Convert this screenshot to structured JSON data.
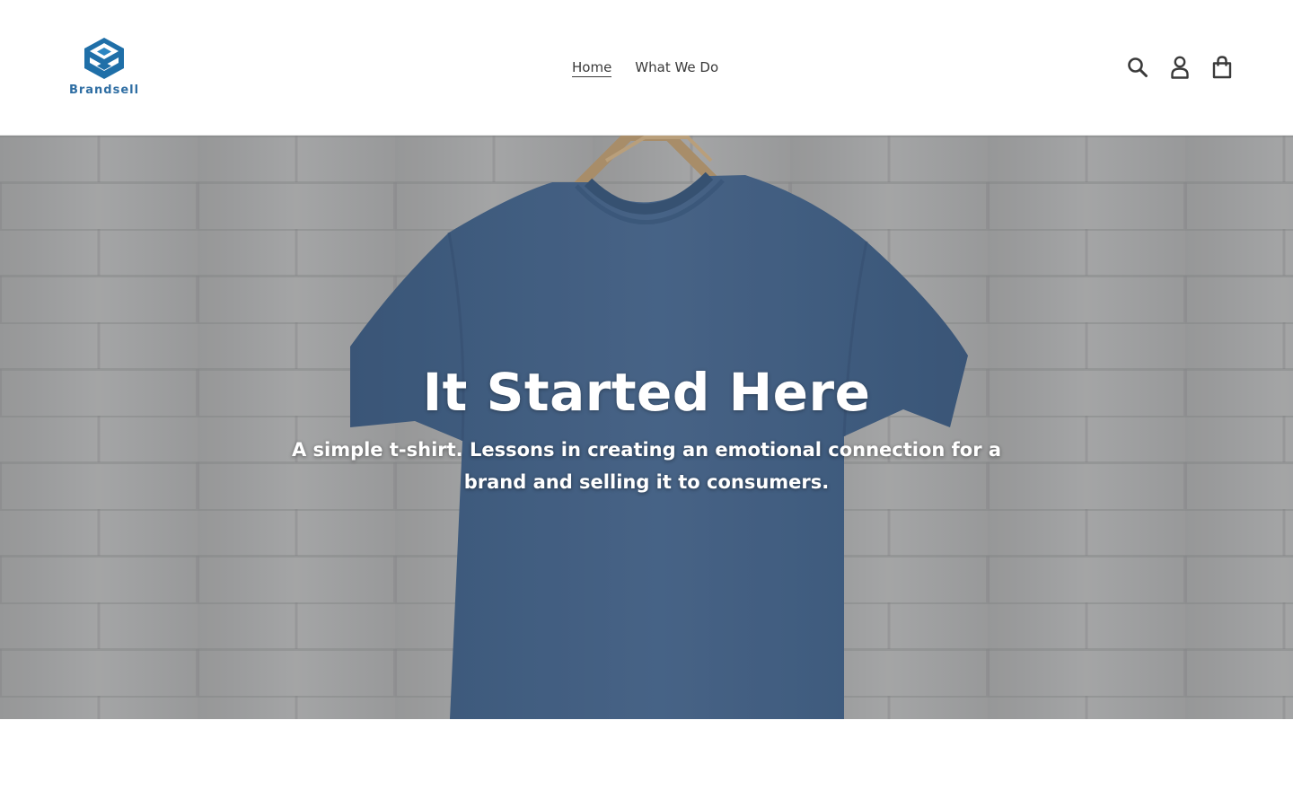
{
  "brand": {
    "name": "Brandsell",
    "logo_icon": "brandsell-logo-icon",
    "color": "#2f6ea3"
  },
  "nav": {
    "items": [
      {
        "label": "Home",
        "active": true
      },
      {
        "label": "What We Do",
        "active": false
      }
    ]
  },
  "header_icons": [
    {
      "name": "search-icon"
    },
    {
      "name": "account-icon"
    },
    {
      "name": "cart-icon"
    }
  ],
  "hero": {
    "title": "It Started Here",
    "subtitle": "A simple t-shirt. Lessons in creating an emotional connection for a brand and selling it to consumers.",
    "image": "blue-tshirt-on-hanger-against-brick-wall",
    "shirt_color": "#4b6a8f",
    "wall_color": "#adaeaf"
  }
}
